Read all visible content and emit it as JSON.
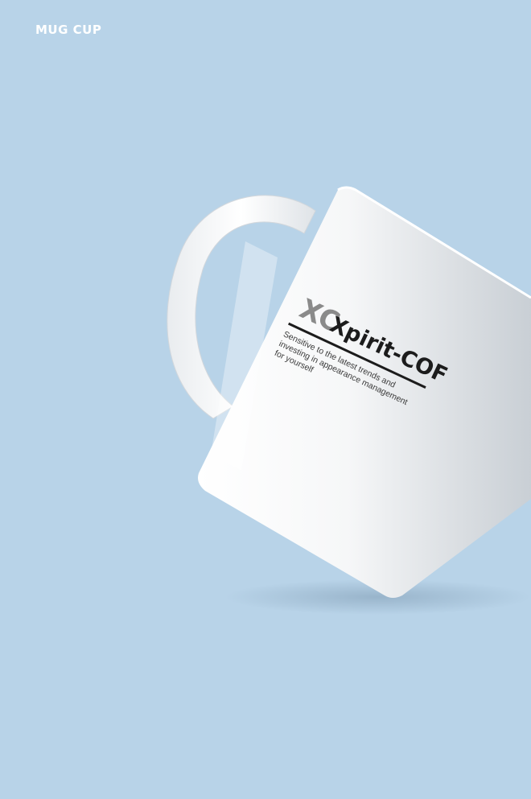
{
  "header": {
    "label": "MUG CUP"
  },
  "mug": {
    "logo_mark": "XC",
    "brand": "Xpirit-COF",
    "tagline_lines": [
      "Sensitive to the latest trends and",
      "investing in appearance management",
      "for yourself"
    ]
  },
  "colors": {
    "background": "#b8d3e8",
    "mug_body": "#f2f3f4",
    "ink": "#1c1c1c",
    "logo_grey": "#8a8a8a"
  }
}
